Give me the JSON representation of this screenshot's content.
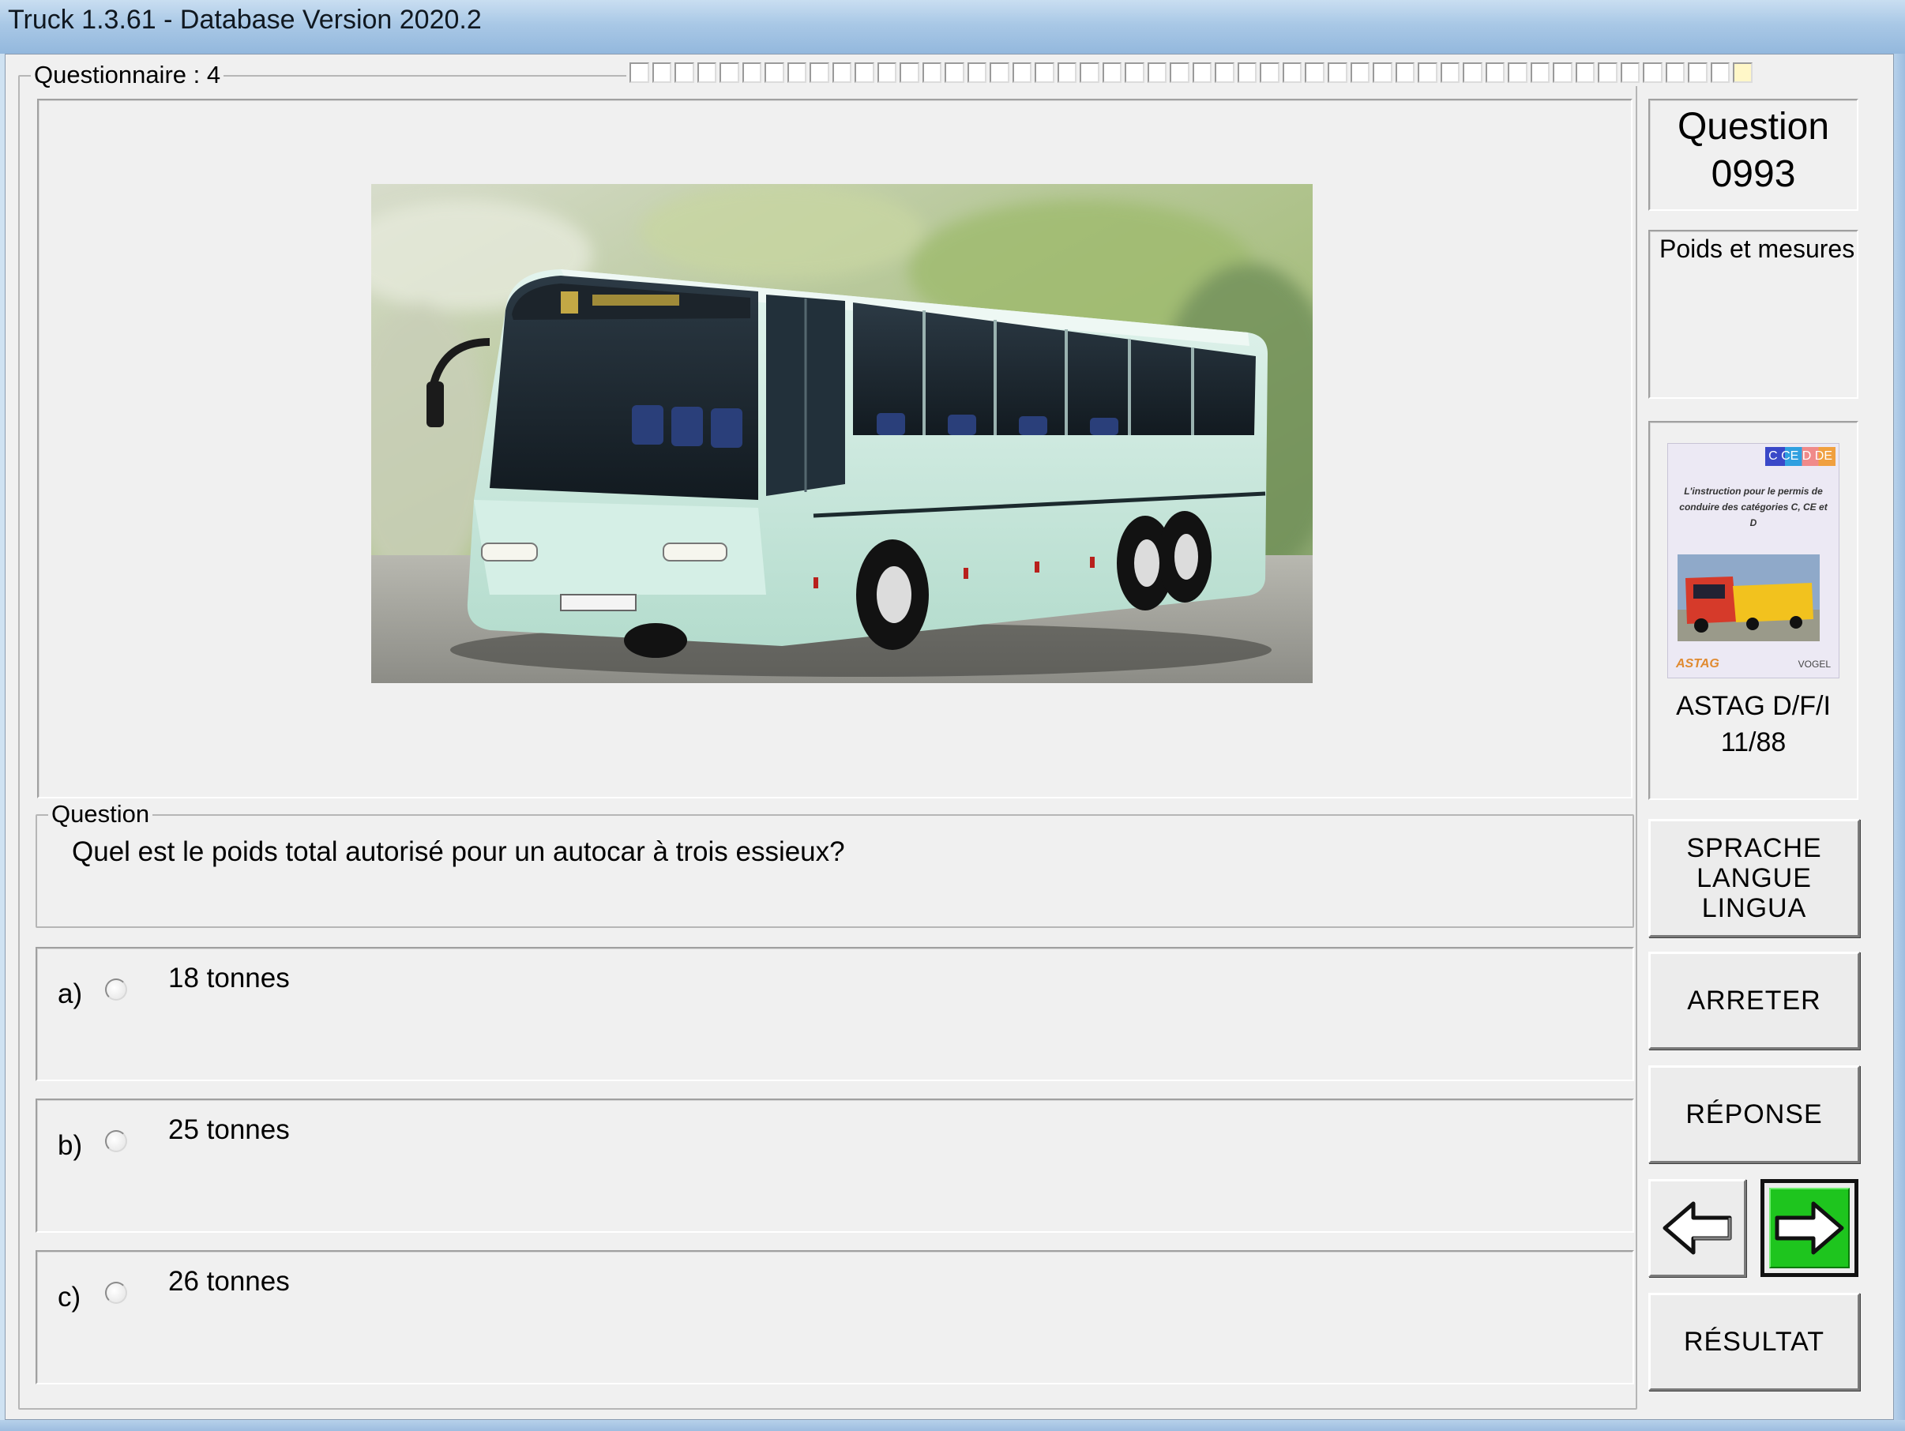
{
  "window": {
    "title": "Truck 1.3.61 - Database Version 2020.2"
  },
  "questionnaire": {
    "label": "Questionnaire : 4",
    "progress_total": 50,
    "progress_done": 1
  },
  "question": {
    "group_label": "Question",
    "text": "Quel est le poids total autorisé pour un autocar à trois essieux?"
  },
  "answers": [
    {
      "letter": "a)",
      "text": "18 tonnes",
      "selected": false
    },
    {
      "letter": "b)",
      "text": "25 tonnes",
      "selected": false
    },
    {
      "letter": "c)",
      "text": "26 tonnes",
      "selected": false
    }
  ],
  "sidebar": {
    "question_label": "Question",
    "question_number": "0993",
    "category": "Poids et mesures",
    "book": {
      "badge": "C CE D DE",
      "cover_text": "L'instruction pour le permis de conduire des catégories C, CE et D",
      "publisher_left": "ASTAG",
      "publisher_right": "VOGEL",
      "source": "ASTAG D/F/I",
      "page": "11/88"
    },
    "language_button": [
      "SPRACHE",
      "LANGUE",
      "LINGUA"
    ],
    "stop_button": "ARRETER",
    "answer_button": "RÉPONSE",
    "prev_icon": "arrow-left-icon",
    "next_icon": "arrow-right-icon",
    "result_button": "RÉSULTAT"
  },
  "colors": {
    "next_button_bg": "#1ec51e",
    "window_bg": "#f0f0f0",
    "bus_body": "#c6e9dd"
  }
}
